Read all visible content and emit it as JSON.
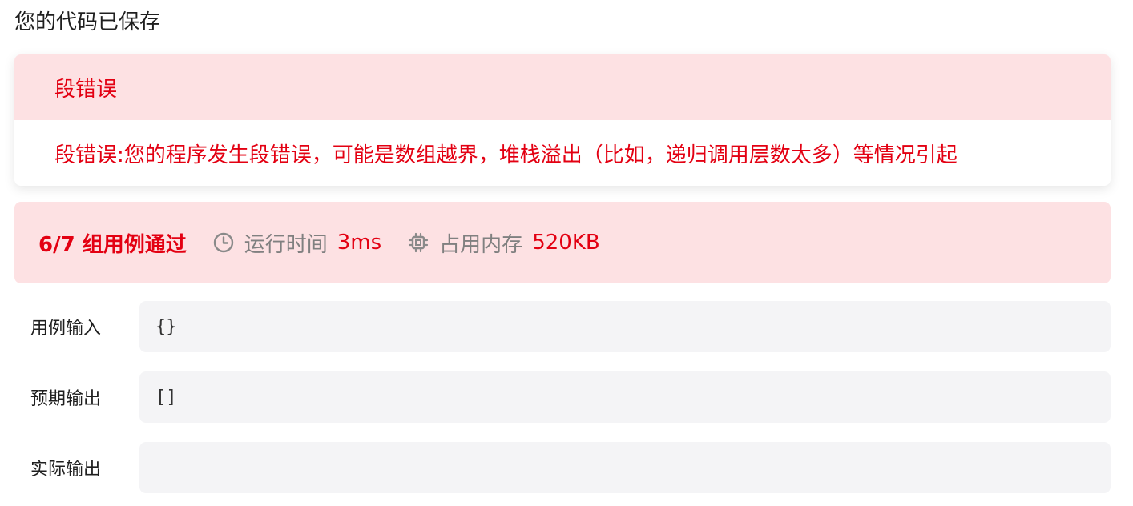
{
  "saved_message": "您的代码已保存",
  "error": {
    "title": "段错误",
    "detail": "段错误:您的程序发生段错误，可能是数组越界，堆栈溢出（比如，递归调用层数太多）等情况引起"
  },
  "summary": {
    "pass_text": "6/7 组用例通过",
    "runtime": {
      "icon": "clock-icon",
      "label": "运行时间",
      "value": "3ms"
    },
    "memory": {
      "icon": "chip-icon",
      "label": "占用内存",
      "value": "520KB"
    }
  },
  "io": {
    "input": {
      "label": "用例输入",
      "value": "{}"
    },
    "expected": {
      "label": "预期输出",
      "value": "[]"
    },
    "actual": {
      "label": "实际输出",
      "value": ""
    }
  },
  "colors": {
    "error_red": "#e30012",
    "error_bg": "#fde1e3",
    "muted_gray": "#808080",
    "io_box_bg": "#f4f4f6"
  }
}
